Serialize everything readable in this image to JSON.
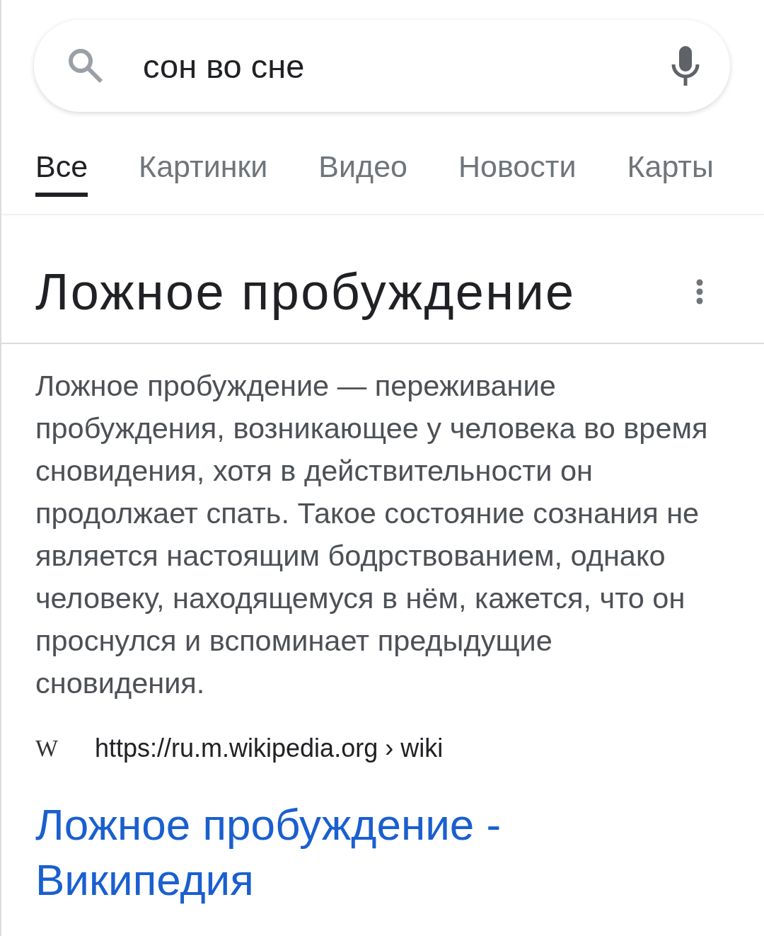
{
  "search": {
    "value": "сон во сне"
  },
  "tabs": [
    {
      "label": "Все",
      "selected": true
    },
    {
      "label": "Картинки",
      "selected": false
    },
    {
      "label": "Видео",
      "selected": false
    },
    {
      "label": "Новости",
      "selected": false
    },
    {
      "label": "Карты",
      "selected": false
    }
  ],
  "panel": {
    "title": "Ложное пробуждение",
    "description": "Ложное пробуждение — переживание пробуждения, возникающее у человека во время сновидения, хотя в действительности он продолжает спать. Такое состояние сознания не является настоящим бодрствованием, однако человеку, находящемуся в нём, кажется, что он проснулся и вспоминает предыдущие сновидения.",
    "source": {
      "favicon": "W",
      "url": "https://ru.m.wikipedia.org › wiki"
    },
    "link": "Ложное пробуждение - Википедия"
  }
}
